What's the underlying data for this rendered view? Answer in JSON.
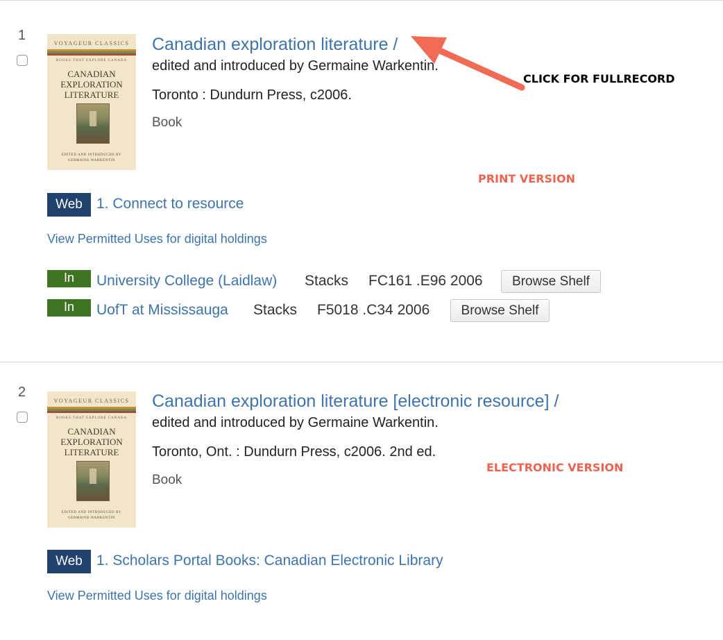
{
  "results": [
    {
      "number": "1",
      "title": "Canadian exploration literature /",
      "author_line": "edited and introduced by Germaine Warkentin.",
      "publication": "Toronto : Dundurn Press, c2006.",
      "format": "Book",
      "cover": {
        "series": "VOYAGEUR CLASSICS",
        "tagline": "BOOKS THAT EXPLORE CANADA",
        "lines": [
          "CANADIAN",
          "EXPLORATION",
          "LITERATURE"
        ],
        "foot1": "EDITED AND INTRODUCED BY",
        "foot2": "GERMAINE WARKENTIN"
      },
      "online": {
        "badge": "Web",
        "link": "1. Connect to resource"
      },
      "permitted_uses": "View Permitted Uses for digital holdings",
      "holdings": [
        {
          "status": "In",
          "library": "University College (Laidlaw)",
          "location": "Stacks",
          "call_number": "FC161 .E96 2006",
          "button": "Browse Shelf"
        },
        {
          "status": "In",
          "library": "UofT at Mississauga",
          "location": "Stacks",
          "call_number": "F5018 .C34 2006",
          "button": "Browse Shelf"
        }
      ]
    },
    {
      "number": "2",
      "title": "Canadian exploration literature [electronic resource] /",
      "author_line": "edited and introduced by Germaine Warkentin.",
      "publication": "Toronto, Ont. : Dundurn Press, c2006. 2nd ed.",
      "format": "Book",
      "cover": {
        "series": "VOYAGEUR CLASSICS",
        "tagline": "BOOKS THAT EXPLORE CANADA",
        "lines": [
          "CANADIAN",
          "EXPLORATION",
          "LITERATURE"
        ],
        "foot1": "EDITED AND INTRODUCED BY",
        "foot2": "GERMAINE WARKENTIN"
      },
      "online": {
        "badge": "Web",
        "link": "1. Scholars Portal Books: Canadian Electronic Library"
      },
      "permitted_uses": "View Permitted Uses for digital holdings"
    }
  ],
  "annotations": {
    "click_note": "CLICK FOR FULLRECORD",
    "print_note": "PRINT VERSION",
    "electronic_note": "ELECTRONIC VERSION"
  },
  "colors": {
    "link": "#3d74ab",
    "web_badge": "#21426e",
    "in_badge": "#3e7322",
    "annotation_red": "#ee6350",
    "arrow": "#f06a55"
  },
  "icons": [
    "checkbox-icon",
    "book-cover-image",
    "arrow-annotation"
  ]
}
